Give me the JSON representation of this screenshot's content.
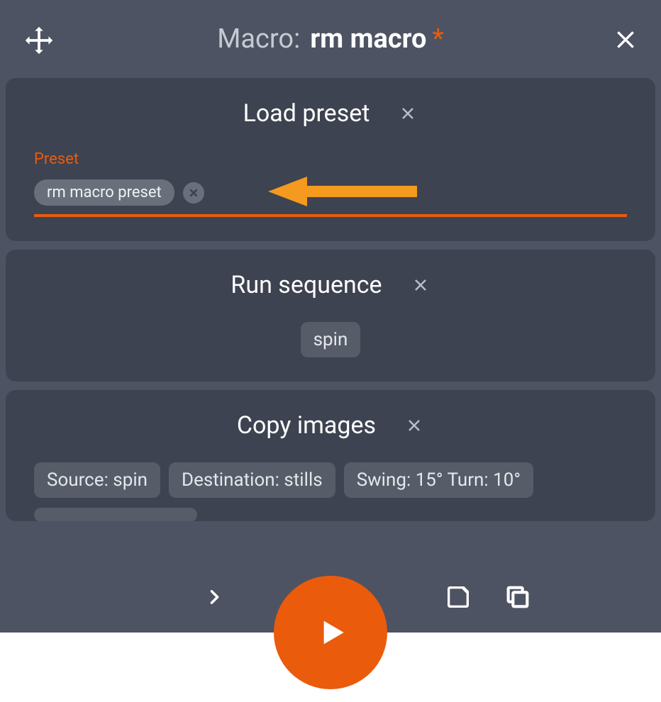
{
  "header": {
    "title_label": "Macro:",
    "macro_name": "rm macro",
    "modified_marker": "*"
  },
  "cards": {
    "load_preset": {
      "title": "Load preset",
      "field_label": "Preset",
      "chip": "rm macro preset"
    },
    "run_sequence": {
      "title": "Run sequence",
      "tag": "spin"
    },
    "copy_images": {
      "title": "Copy images",
      "tags": [
        "Source: spin",
        "Destination: stills",
        "Swing: 15°  Turn: 10°"
      ]
    }
  },
  "colors": {
    "accent": "#ea5b0c",
    "bg": "#4d5362",
    "card": "#3d4350"
  }
}
